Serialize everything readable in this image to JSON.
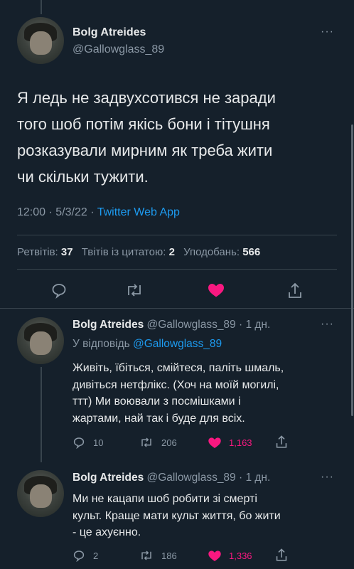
{
  "main_tweet": {
    "author_name": "Bolg Atreides",
    "author_handle": "@Gallowglass_89",
    "more": "···",
    "text_lines": [
      "Я ледь не задвухсотився не заради",
      "того шоб потім якісь бони і тітушня",
      "розказували мирним як треба жити",
      "чи скільки тужити."
    ],
    "time": "12:00",
    "date": "5/3/22",
    "sep": "·",
    "client": "Twitter Web App",
    "retweets_label": "Ретвітів:",
    "retweets": "37",
    "quotes_label": "Твітів із цитатою:",
    "quotes": "2",
    "likes_label": "Уподобань:",
    "likes": "566",
    "liked": true
  },
  "replies": [
    {
      "author_name": "Bolg Atreides",
      "author_handle": "@Gallowglass_89 · 1 дн.",
      "more": "···",
      "reply_to_label": "У відповідь",
      "reply_to_handle": "@Gallowglass_89",
      "text_lines": [
        "Живіть, їбіться, смійтеся, паліть шмаль,",
        "дивіться нетфлікс. (Хоч на моїй могилі,",
        "ттт) Ми воювали з посмішками і",
        "жартами, най так і буде для всіх."
      ],
      "replies": "10",
      "retweets": "206",
      "likes": "1,163"
    },
    {
      "author_name": "Bolg Atreides",
      "author_handle": "@Gallowglass_89 · 1 дн.",
      "more": "···",
      "text_lines": [
        "Ми не кацапи шоб робити зі смерті",
        "культ. Краще мати культ життя, бо жити",
        "- це ахуєнно."
      ],
      "replies": "2",
      "retweets": "186",
      "likes": "1,336"
    }
  ],
  "colors": {
    "background": "#15202b",
    "accent": "#1d9bf0",
    "like": "#f91880",
    "muted": "#8b98a5"
  }
}
